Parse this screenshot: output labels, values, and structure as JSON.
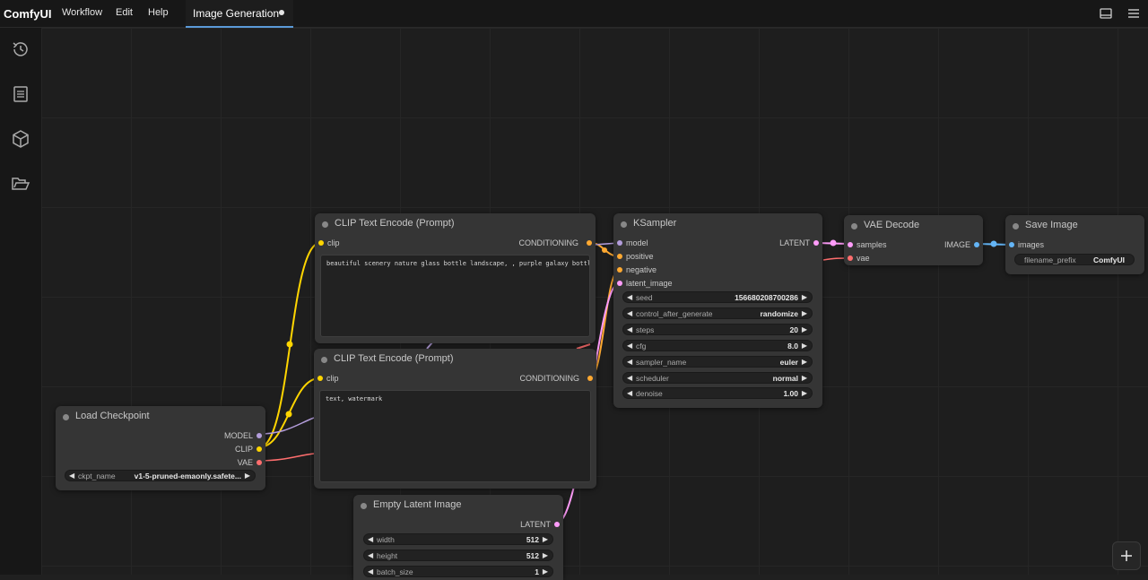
{
  "app": {
    "name": "ComfyUI"
  },
  "menu": {
    "workflow": "Workflow",
    "edit": "Edit",
    "help": "Help"
  },
  "tab": {
    "label": "Image Generation"
  },
  "icons": {
    "history": "history-icon",
    "queue": "document-icon",
    "models": "cube-icon",
    "workflows": "folder-icon",
    "bottom_panel": "panel-icon",
    "menu": "hamburger-icon",
    "add": "plus-icon"
  },
  "colors": {
    "accent": "#5b9ad8",
    "clip": "#ffd500",
    "model": "#b39ddb",
    "vae": "#ff6e6e",
    "conditioning": "#ffa931",
    "latent": "#ff9cf9",
    "image": "#64b5f6"
  },
  "nodes": {
    "clip_pos": {
      "title": "CLIP Text Encode (Prompt)",
      "in_clip": "clip",
      "out": "CONDITIONING",
      "text": "beautiful scenery nature glass bottle landscape, , purple galaxy bottle,"
    },
    "clip_neg": {
      "title": "CLIP Text Encode (Prompt)",
      "in_clip": "clip",
      "out": "CONDITIONING",
      "text": "text, watermark"
    },
    "ksampler": {
      "title": "KSampler",
      "inputs": [
        "model",
        "positive",
        "negative",
        "latent_image"
      ],
      "out": "LATENT",
      "widgets": [
        {
          "name": "seed",
          "value": "156680208700286"
        },
        {
          "name": "control_after_generate",
          "value": "randomize"
        },
        {
          "name": "steps",
          "value": "20"
        },
        {
          "name": "cfg",
          "value": "8.0"
        },
        {
          "name": "sampler_name",
          "value": "euler"
        },
        {
          "name": "scheduler",
          "value": "normal"
        },
        {
          "name": "denoise",
          "value": "1.00"
        }
      ]
    },
    "vae_decode": {
      "title": "VAE Decode",
      "in_samples": "samples",
      "in_vae": "vae",
      "out": "IMAGE"
    },
    "save_image": {
      "title": "Save Image",
      "in_images": "images",
      "widget_name": "filename_prefix",
      "widget_value": "ComfyUI"
    },
    "checkpoint": {
      "title": "Load Checkpoint",
      "out_model": "MODEL",
      "out_clip": "CLIP",
      "out_vae": "VAE",
      "widget_name": "ckpt_name",
      "widget_value": "v1-5-pruned-emaonly.safete..."
    },
    "latent": {
      "title": "Empty Latent Image",
      "out": "LATENT",
      "widgets": [
        {
          "name": "width",
          "value": "512"
        },
        {
          "name": "height",
          "value": "512"
        },
        {
          "name": "batch_size",
          "value": "1"
        }
      ]
    }
  }
}
